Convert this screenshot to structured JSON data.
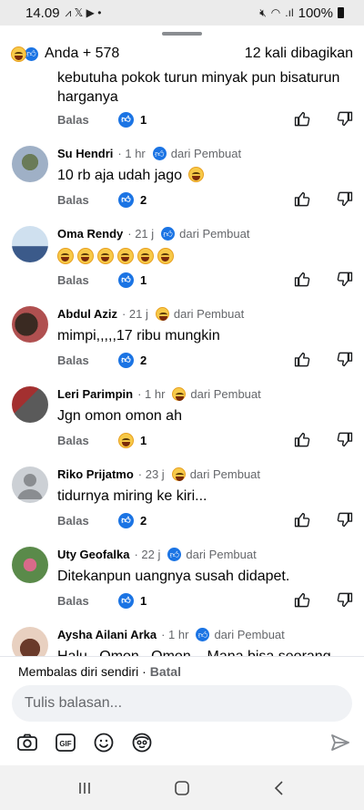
{
  "status": {
    "time": "14.09",
    "battery": "100%"
  },
  "reactions": {
    "label": "Anda + 578",
    "shares": "12 kali dibagikan"
  },
  "top_comment": {
    "text_line1": "kebutuha pokok turun minyak pun bisaturun",
    "text_line2": "harganya",
    "reply_label": "Balas",
    "reaction_count": "1"
  },
  "comments": [
    {
      "name": "Su Hendri",
      "time": "· 1 hr",
      "badge": "dari Pembuat",
      "text": "10 rb aja udah jago",
      "reply_label": "Balas",
      "reaction_count": "2"
    },
    {
      "name": "Oma Rendy",
      "time": "· 21 j",
      "badge": "dari Pembuat",
      "text": "",
      "reply_label": "Balas",
      "reaction_count": "1"
    },
    {
      "name": "Abdul Aziz",
      "time": "· 21 j",
      "badge": "dari Pembuat",
      "text": "mimpi,,,,,17 ribu mungkin",
      "reply_label": "Balas",
      "reaction_count": "2"
    },
    {
      "name": "Leri Parimpin",
      "time": "· 1 hr",
      "badge": "dari Pembuat",
      "text": "Jgn omon omon ah",
      "reply_label": "Balas",
      "reaction_count": "1"
    },
    {
      "name": "Riko Prijatmo",
      "time": "· 23 j",
      "badge": "dari Pembuat",
      "text": "tidurnya miring ke kiri...",
      "reply_label": "Balas",
      "reaction_count": "2"
    },
    {
      "name": "Uty Geofalka",
      "time": "· 22 j",
      "badge": "dari Pembuat",
      "text": "Ditekanpun uangnya susah didapet.",
      "reply_label": "Balas",
      "reaction_count": "1"
    },
    {
      "name": "Aysha Ailani Arka",
      "time": "· 1 hr",
      "badge": "dari Pembuat",
      "text": "Halu...Omon...Omon....Mana bisa seorang"
    }
  ],
  "reply_area": {
    "replying_to": "Membalas diri sendiri · ",
    "cancel": "Batal",
    "placeholder": "Tulis balasan..."
  },
  "icons": {
    "camera": "camera-icon",
    "gif": "gif-icon",
    "emoji": "emoji-icon",
    "avatar_sticker": "avatar-sticker-icon",
    "send": "send-icon"
  },
  "colors": {
    "facebook_blue": "#1b74e4",
    "muted_text": "#65676b",
    "input_bg": "#f0f2f5"
  }
}
